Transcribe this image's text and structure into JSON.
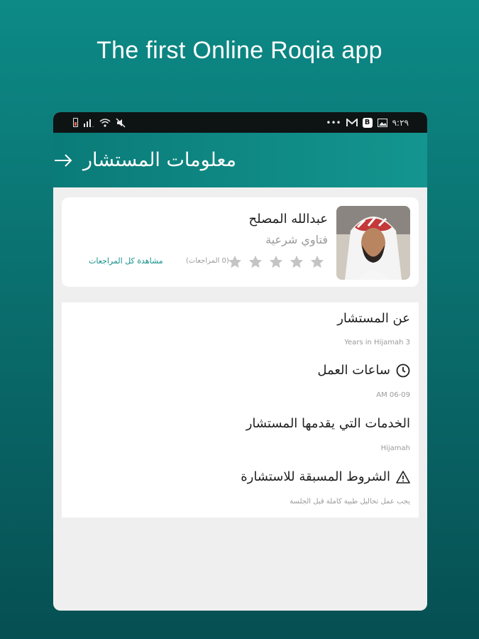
{
  "promo": {
    "title": "The first Online Roqia app"
  },
  "status_bar": {
    "time": "٩:٢٩",
    "left_icons": [
      "battery-icon",
      "signal-icon",
      "wifi-icon",
      "mute-icon"
    ],
    "right_icons": [
      "more-dots-icon",
      "gmail-icon",
      "b-app-icon",
      "gallery-icon"
    ],
    "dots": "•••",
    "b_label": "B"
  },
  "app_bar": {
    "title": "معلومات المستشار"
  },
  "consultant": {
    "name": "عبدالله المصلح",
    "specialty": "فتاوي شرعية",
    "rating_stars": 0,
    "max_stars": 5,
    "review_count_text": "(0 المراجعات)",
    "all_reviews_link": "مشاهدة كل المراجعات"
  },
  "details": {
    "about": {
      "title": "عن المستشار",
      "value": "Years in Hijamah 3"
    },
    "hours": {
      "title": "ساعات العمل",
      "value": "AM 06-09"
    },
    "services": {
      "title": "الخدمات التي يقدمها المستشار",
      "value": "Hijamah"
    },
    "prerequisites": {
      "title": "الشروط المسبقة للاستشارة",
      "value": "يجب عمل تحاليل طبية كاملة قبل الجلسة"
    }
  },
  "colors": {
    "primary": "#0e8f8a",
    "link": "#12908a",
    "star_empty": "#c4c4c4",
    "status_bar": "#0e1414"
  }
}
